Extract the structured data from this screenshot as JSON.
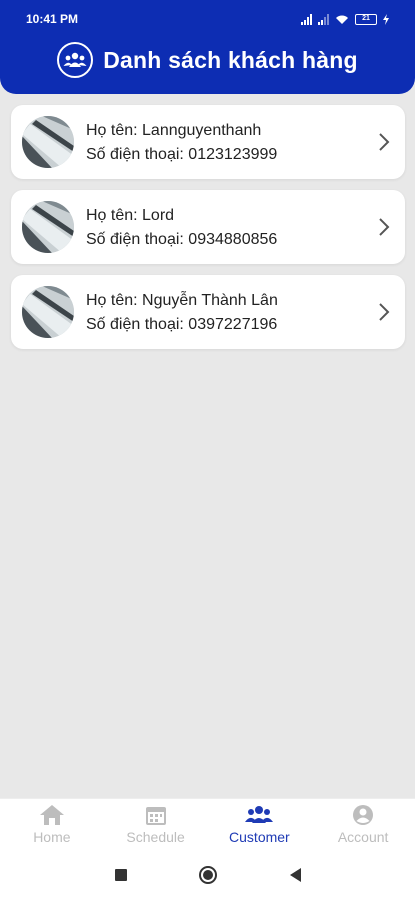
{
  "status_bar": {
    "time": "10:41 PM",
    "battery": "21"
  },
  "header": {
    "title": "Danh sách khách hàng",
    "icon": "customers-group-icon"
  },
  "customers": [
    {
      "name_label": "Họ tên: Lannguyenthanh",
      "phone_label": "Số điện thoại: 0123123999"
    },
    {
      "name_label": "Họ tên: Lord",
      "phone_label": "Số điện thoại: 0934880856"
    },
    {
      "name_label": "Họ tên: Nguyễn Thành Lân",
      "phone_label": "Số điện thoại: 0397227196"
    }
  ],
  "bottom_nav": {
    "items": [
      {
        "label": "Home",
        "icon": "home-icon"
      },
      {
        "label": "Schedule",
        "icon": "calendar-icon"
      },
      {
        "label": "Customer",
        "icon": "people-icon"
      },
      {
        "label": "Account",
        "icon": "account-icon"
      }
    ],
    "active": "Customer"
  },
  "colors": {
    "header": "#0d2db3",
    "background": "#e8e8e8",
    "active_nav": "#1f3bb5",
    "inactive_nav": "#bdbdbd"
  }
}
